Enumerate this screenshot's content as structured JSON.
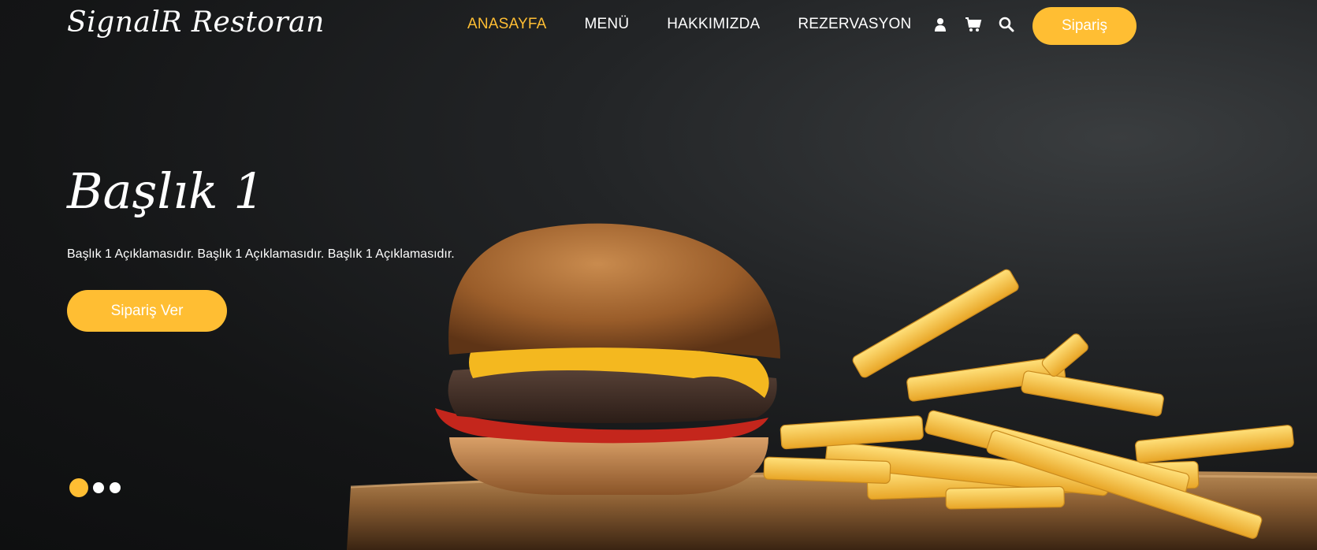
{
  "brand": {
    "name": "SignalR Restoran"
  },
  "nav": {
    "items": [
      {
        "label": "ANASAYFA",
        "active": true
      },
      {
        "label": "MENÜ",
        "active": false
      },
      {
        "label": "HAKKIMIZDA",
        "active": false
      },
      {
        "label": "REZERVASYON",
        "active": false
      }
    ],
    "icons": [
      "user-icon",
      "cart-icon",
      "search-icon"
    ],
    "order_label": "Sipariş"
  },
  "hero": {
    "title": "Başlık 1",
    "description": "Başlık 1 Açıklamasıdır. Başlık 1 Açıklamasıdır. Başlık 1 Açıklamasıdır.",
    "button_label": "Sipariş Ver",
    "image": "burger-and-fries-photo",
    "slides": 3,
    "active_slide": 1
  },
  "colors": {
    "accent": "#ffbe33",
    "text": "#ffffff",
    "background": "#151617"
  }
}
